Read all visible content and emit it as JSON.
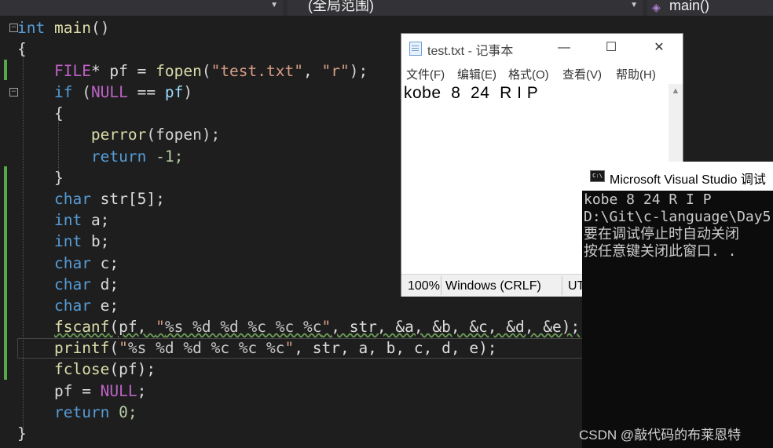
{
  "nav": {
    "scope": "(全局范围)",
    "function": "main()"
  },
  "code": {
    "l1": "main",
    "l3_file": "FILE",
    "l3_star": "* pf = ",
    "l3_fopen": "fopen",
    "l3_open": "(",
    "l3_str1": "\"test.txt\"",
    "l3_comma": ", ",
    "l3_str2": "\"r\"",
    "l3_end": ");",
    "l4_if": "if",
    "l4_open": " (",
    "l4_null": "NULL",
    "l4_eq": " == ",
    "l4_pf": "pf",
    "l4_close": ")",
    "l6_perror": "perror",
    "l6_args": "(fopen);",
    "l7_return": "return",
    "l7_rest": " -1;",
    "l9_char": "char",
    "l9_rest": " str[5];",
    "l10_int": "int",
    "l10_rest": " a;",
    "l11_int": "int",
    "l11_rest": " b;",
    "l12_char": "char",
    "l12_rest": " c;",
    "l13_char": "char",
    "l13_rest": " d;",
    "l14_char": "char",
    "l14_rest": " e;",
    "l15_fscanf": "fscanf",
    "l15_a": "(pf, ",
    "l15_q1": "\"",
    "l15_fmt": "%s %d %d %c %c %c",
    "l15_q2": "\"",
    "l15_b": ", str, &a, &b, &c, &d, &e);",
    "l16_printf": "printf",
    "l16_a": "(",
    "l16_q1": "\"",
    "l16_fmt": "%s %d %d %c %c %c",
    "l16_q2": "\"",
    "l16_b": ", str, a, b, c, d, e);",
    "l17_fclose": "fclose",
    "l17_rest": "(pf);",
    "l18_a": "pf = ",
    "l18_null": "NULL",
    "l18_end": ";",
    "l19_return": "return",
    "l19_rest": " 0;",
    "kw_int": "int"
  },
  "notepad": {
    "title": "test.txt - 记事本",
    "menu": [
      "文件(F)",
      "编辑(E)",
      "格式(O)",
      "查看(V)",
      "帮助(H)"
    ],
    "content": "kobe  8  24  R I P",
    "status": {
      "zoom": "100%",
      "eol": "Windows (CRLF)",
      "enc": "UT"
    },
    "btn_min": "—",
    "btn_max": "☐",
    "btn_close": "✕"
  },
  "console": {
    "title": "Microsoft Visual Studio 调试",
    "lines": [
      "kobe 8 24 R I P",
      "D:\\Git\\c-language\\Day5",
      "要在调试停止时自动关闭",
      "按任意键关闭此窗口. ."
    ]
  },
  "watermark": "CSDN @敲代码的布莱恩特",
  "icons": {
    "cube": "vs-cube-icon",
    "notepad": "notepad-icon",
    "console": "console-icon"
  }
}
